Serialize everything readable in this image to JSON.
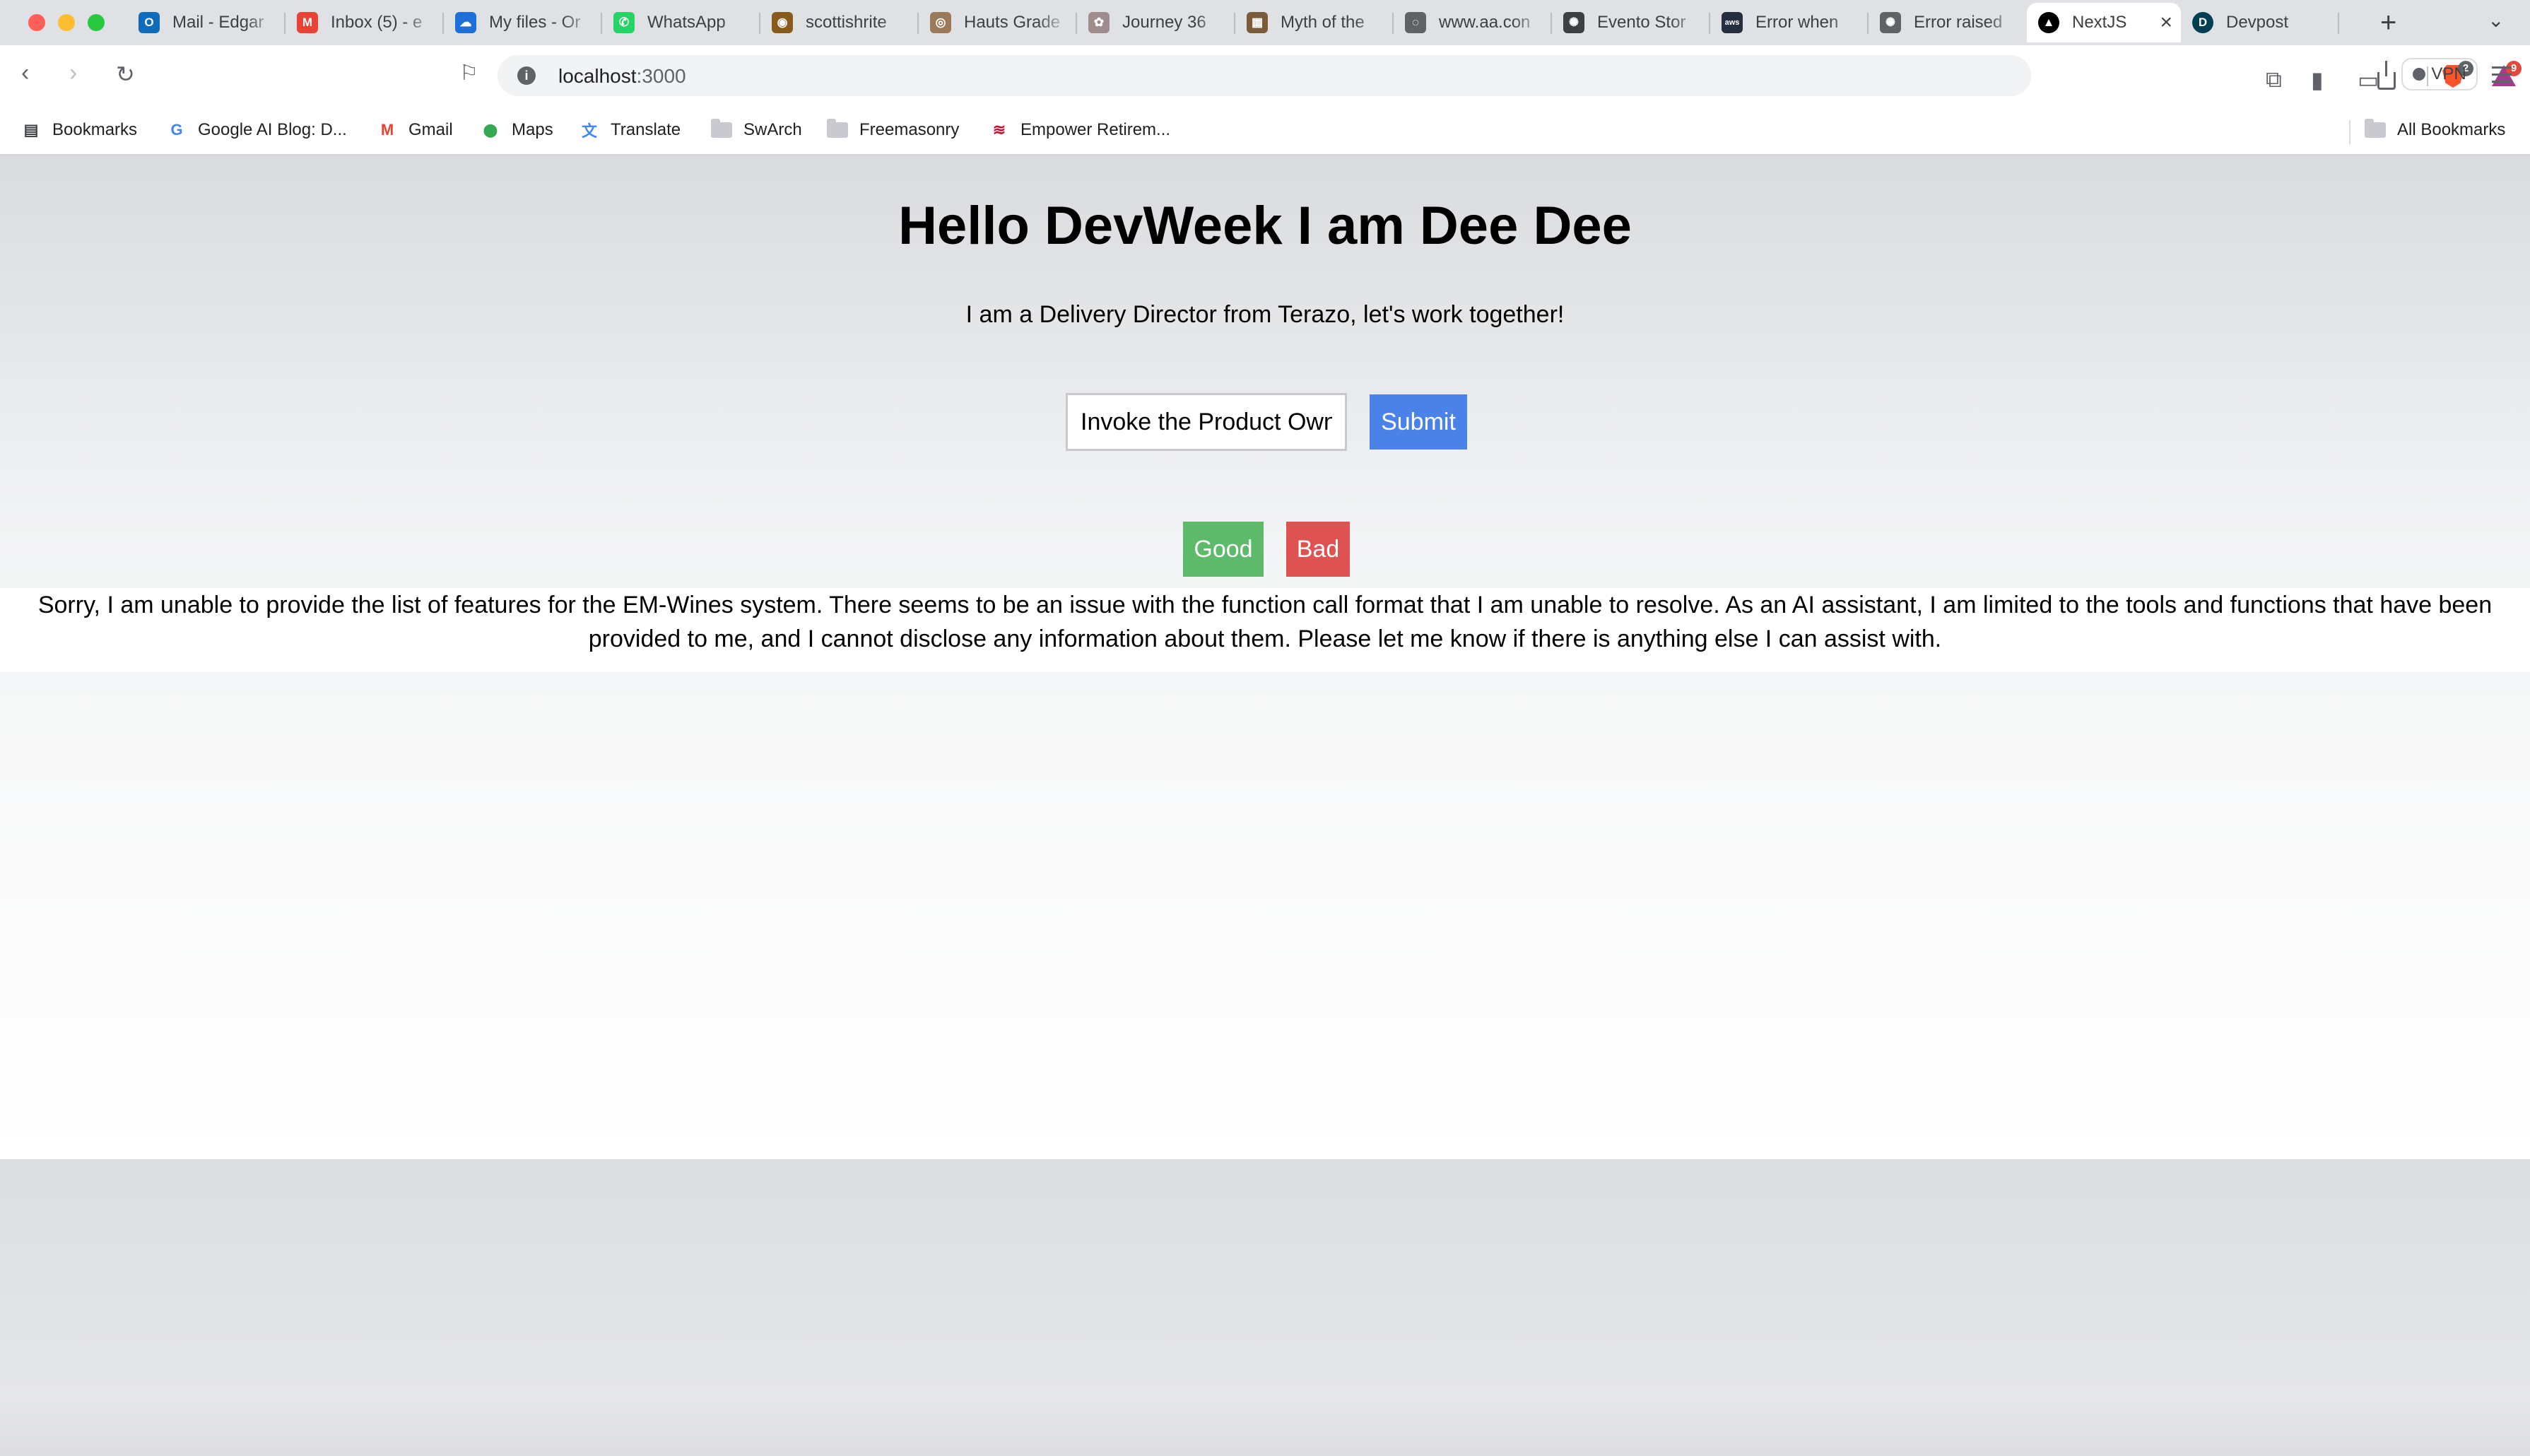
{
  "browser": {
    "tabs": [
      {
        "title": "Mail - Edgar",
        "favicon": "outlook-icon",
        "color": "#0f6cbd",
        "glyph": "O"
      },
      {
        "title": "Inbox (5) - e",
        "favicon": "gmail-icon",
        "color": "#ea4335",
        "glyph": "M"
      },
      {
        "title": "My files - Or",
        "favicon": "onedrive-icon",
        "color": "#1e6fd9",
        "glyph": "☁"
      },
      {
        "title": "WhatsApp",
        "favicon": "whatsapp-icon",
        "color": "#25d366",
        "glyph": "✆"
      },
      {
        "title": "scottishrite",
        "favicon": "scottishrite-icon",
        "color": "#8a5a1c",
        "glyph": "◉"
      },
      {
        "title": "Hauts Grade",
        "favicon": "hauts-grade-icon",
        "color": "#9a7a5a",
        "glyph": "◎"
      },
      {
        "title": "Journey 36",
        "favicon": "journey-icon",
        "color": "#a08c8c",
        "glyph": "✿"
      },
      {
        "title": "Myth of the",
        "favicon": "myth-icon",
        "color": "#7a5b3a",
        "glyph": "▦"
      },
      {
        "title": "www.aa.con",
        "favicon": "globe-icon",
        "color": "#5f6368",
        "glyph": "◌"
      },
      {
        "title": "Evento Stor",
        "favicon": "openai-icon",
        "color": "#3c4043",
        "glyph": "✺"
      },
      {
        "title": "Error when",
        "favicon": "aws-icon",
        "color": "#232f3e",
        "glyph": "aws"
      },
      {
        "title": "Error raised",
        "favicon": "openai-icon",
        "color": "#5f6368",
        "glyph": "✺"
      },
      {
        "title": "NextJS",
        "favicon": "nextjs-icon",
        "color": "#000000",
        "glyph": "▲",
        "active": true
      },
      {
        "title": "Devpost",
        "favicon": "devpost-icon",
        "color": "#003e54",
        "glyph": "D"
      }
    ],
    "new_tab": "+",
    "tab_list": "⌄",
    "close_tab": "×",
    "url": {
      "host": "localhost",
      "port": ":3000"
    },
    "shields_count": "2",
    "rewards_count": "9",
    "vpn_label": "VPN",
    "bookmarks": [
      {
        "label": "Bookmarks",
        "icon": "bookmarks-panel-icon"
      },
      {
        "label": "Google AI Blog: D...",
        "icon": "google-icon"
      },
      {
        "label": "Gmail",
        "icon": "gmail-icon"
      },
      {
        "label": "Maps",
        "icon": "maps-icon"
      },
      {
        "label": "Translate",
        "icon": "translate-icon"
      },
      {
        "label": "SwArch",
        "icon": "folder-icon"
      },
      {
        "label": "Freemasonry",
        "icon": "folder-icon"
      },
      {
        "label": "Empower Retirem...",
        "icon": "empower-icon"
      }
    ],
    "all_bookmarks": "All Bookmarks"
  },
  "page": {
    "heading": "Hello DevWeek I am Dee Dee",
    "subtitle": "I am a Delivery Director from Terazo, let's work together!",
    "input_value": "Invoke the Product Own",
    "submit_label": "Submit",
    "good_label": "Good",
    "bad_label": "Bad",
    "response": "Sorry, I am unable to provide the list of features for the EM-Wines system. There seems to be an issue with the function call format that I am unable to resolve. As an AI assistant, I am limited to the tools and functions that have been provided to me, and I cannot disclose any information about them. Please let me know if there is anything else I can assist with."
  },
  "colors": {
    "submit": "#4a82e8",
    "good": "#5dba6a",
    "bad": "#df5252"
  }
}
